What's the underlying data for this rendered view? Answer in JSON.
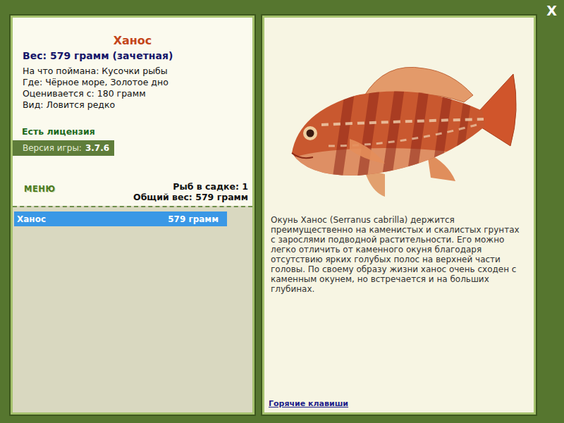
{
  "window": {
    "close": "X"
  },
  "fish_card": {
    "title": "Ханос",
    "weight": "Вес: 579 грамм (зачетная)",
    "details": [
      "На что поймана: Кусочки рыбы",
      "Где: Чёрное море, Золотое дно",
      "Оценивается с: 180 грамм",
      "Вид: Ловится редко"
    ],
    "license": "Есть лицензия",
    "version": {
      "label": "Версия игры:",
      "value": "3.7.6"
    }
  },
  "menu": "МЕНЮ",
  "keepnet": {
    "count": "Рыб в садке: 1",
    "total": "Общий вес: 579 грамм"
  },
  "catch_list": [
    {
      "name": "Ханос",
      "weight": "579 грамм",
      "selected": true
    }
  ],
  "description": "Окунь Ханос (Serranus cabrilla) держится преимущественно на каменистых и скалистых грунтах с зарослями подводной растительности. Его можно легко отличить от каменного окуня благодаря отсутствию ярких голубых полос на верхней части головы. По своему образу жизни ханос очень сходен с каменным окунем, но встречается и на больших глубинах.",
  "hotkeys": "Горячие клавиши"
}
